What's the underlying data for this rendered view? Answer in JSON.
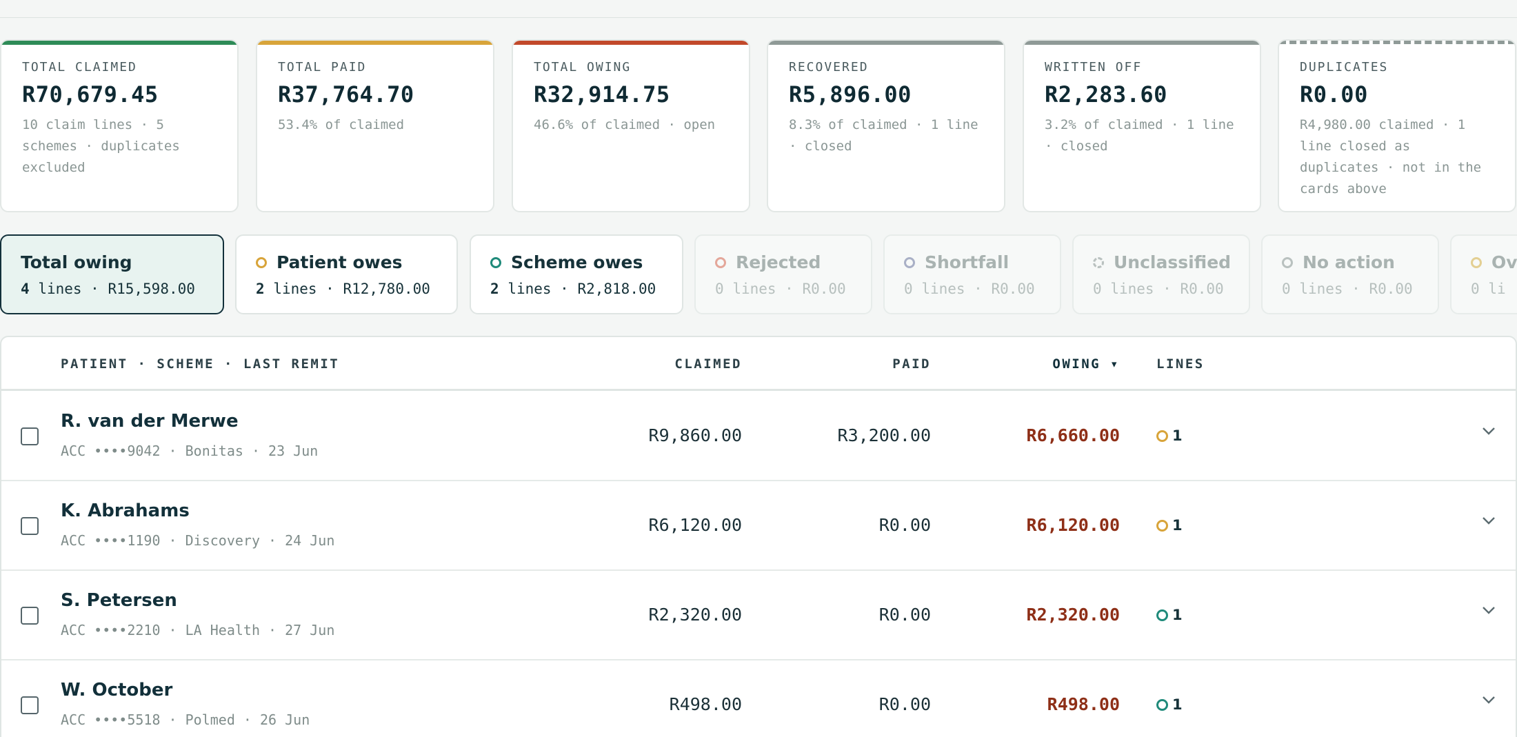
{
  "colors": {
    "claimed_accent": "#2e8b57",
    "paid_accent": "#d8a43a",
    "owing_accent": "#c2492b",
    "neutral_accent": "#8f9a97",
    "owing_text": "#8e2f17",
    "active_tab_bg": "#e8f3f0"
  },
  "summary_cards": [
    {
      "label": "TOTAL CLAIMED",
      "value": "R70,679.45",
      "sub": "10 claim lines · 5 schemes · duplicates excluded"
    },
    {
      "label": "TOTAL PAID",
      "value": "R37,764.70",
      "sub": "53.4% of claimed"
    },
    {
      "label": "TOTAL OWING",
      "value": "R32,914.75",
      "sub": "46.6% of claimed · open"
    },
    {
      "label": "RECOVERED",
      "value": "R5,896.00",
      "sub": "8.3% of claimed · 1 line · closed"
    },
    {
      "label": "WRITTEN OFF",
      "value": "R2,283.60",
      "sub": "3.2% of claimed · 1 line · closed"
    },
    {
      "label": "DUPLICATES",
      "value": "R0.00",
      "sub": "R4,980.00 claimed · 1 line closed as duplicates · not in the cards above"
    }
  ],
  "filter_tabs": [
    {
      "title": "Total owing",
      "count": "4",
      "unit": "lines",
      "amount": "R15,598.00",
      "state": "active",
      "dot": "none"
    },
    {
      "title": "Patient owes",
      "count": "2",
      "unit": "lines",
      "amount": "R12,780.00",
      "state": "normal",
      "dot": "#d8a43a"
    },
    {
      "title": "Scheme owes",
      "count": "2",
      "unit": "lines",
      "amount": "R2,818.00",
      "state": "normal",
      "dot": "#1f8a7a"
    },
    {
      "title": "Rejected",
      "count": "0",
      "unit": "lines",
      "amount": "R0.00",
      "state": "dim",
      "dot": "#e4a79a"
    },
    {
      "title": "Shortfall",
      "count": "0",
      "unit": "lines",
      "amount": "R0.00",
      "state": "dim",
      "dot": "#a9b0c6"
    },
    {
      "title": "Unclassified",
      "count": "0",
      "unit": "lines",
      "amount": "R0.00",
      "state": "dim",
      "dot": "#b9c1bf"
    },
    {
      "title": "No action",
      "count": "0",
      "unit": "lines",
      "amount": "R0.00",
      "state": "dim",
      "dot": "#b9c1bf"
    },
    {
      "title": "Ov",
      "count": "0",
      "unit": "li",
      "amount": "",
      "state": "dim",
      "dot": "#e3cf92"
    }
  ],
  "table": {
    "headers": {
      "patient": "PATIENT · SCHEME · LAST REMIT",
      "claimed": "CLAIMED",
      "paid": "PAID",
      "owing": "OWING ▾",
      "lines": "LINES"
    },
    "rows": [
      {
        "name": "R. van der Merwe",
        "meta": "ACC ••••9042 · Bonitas · 23 Jun",
        "claimed": "R9,860.00",
        "paid": "R3,200.00",
        "owing": "R6,660.00",
        "lines": "1",
        "dot": "#d8a43a"
      },
      {
        "name": "K. Abrahams",
        "meta": "ACC ••••1190 · Discovery · 24 Jun",
        "claimed": "R6,120.00",
        "paid": "R0.00",
        "owing": "R6,120.00",
        "lines": "1",
        "dot": "#d8a43a"
      },
      {
        "name": "S. Petersen",
        "meta": "ACC ••••2210 · LA Health · 27 Jun",
        "claimed": "R2,320.00",
        "paid": "R0.00",
        "owing": "R2,320.00",
        "lines": "1",
        "dot": "#1f8a7a"
      },
      {
        "name": "W. October",
        "meta": "ACC ••••5518 · Polmed · 26 Jun",
        "claimed": "R498.00",
        "paid": "R0.00",
        "owing": "R498.00",
        "lines": "1",
        "dot": "#1f8a7a"
      }
    ]
  }
}
